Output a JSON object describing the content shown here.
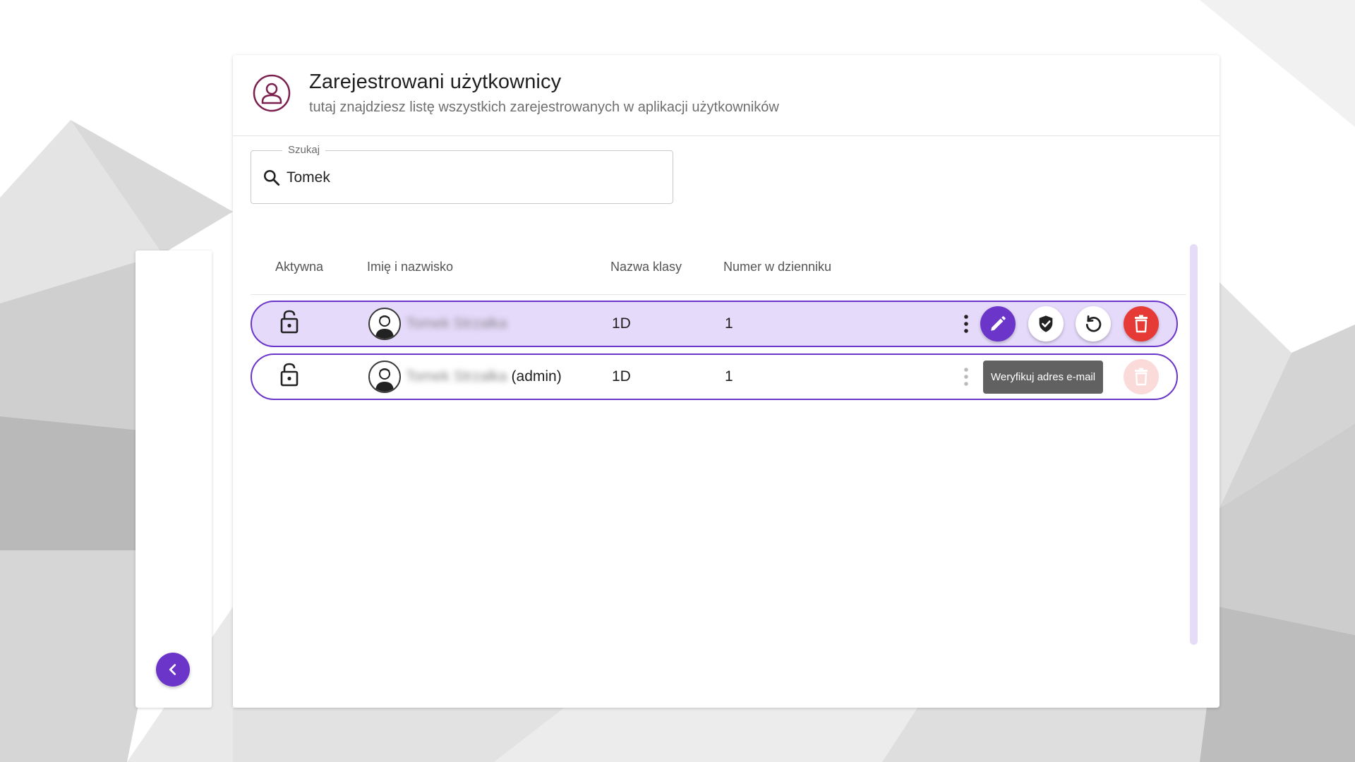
{
  "header": {
    "title": "Zarejestrowani użytkownicy",
    "subtitle": "tutaj znajdziesz listę wszystkich zarejestrowanych w aplikacji użytkowników"
  },
  "search": {
    "label": "Szukaj",
    "value": "Tomek"
  },
  "table": {
    "columns": {
      "active": "Aktywna",
      "name": "Imię i nazwisko",
      "class": "Nazwa klasy",
      "number": "Numer w dzienniku"
    },
    "rows": [
      {
        "name": "Tomek Strzałka",
        "suffix": "",
        "class": "1D",
        "number": "1",
        "selected": true
      },
      {
        "name": "Tomek Strzałka",
        "suffix": "(admin)",
        "class": "1D",
        "number": "1",
        "selected": false
      }
    ]
  },
  "tooltip": {
    "text": "Weryfikuj adres e-mail"
  },
  "colors": {
    "accent": "#6a35c8",
    "selected_row": "#e6dafb",
    "delete": "#e53a35",
    "brand_icon": "#7b1f4f"
  },
  "icons": [
    "user-circle-icon",
    "search-icon",
    "lock-open-icon",
    "avatar-icon",
    "more-vert-icon",
    "pencil-icon",
    "shield-check-icon",
    "reset-icon",
    "trash-icon",
    "chevron-left-icon"
  ]
}
